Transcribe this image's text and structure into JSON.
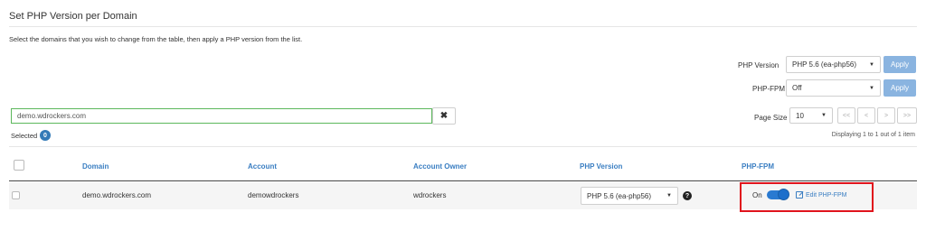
{
  "page": {
    "title": "Set PHP Version per Domain",
    "description": "Select the domains that you wish to change from the table, then apply a PHP version from the list."
  },
  "controls": {
    "php_version_label": "PHP Version",
    "php_version_value": "PHP 5.6 (ea-php56)",
    "php_fpm_label": "PHP-FPM",
    "php_fpm_value": "Off",
    "apply_label": "Apply"
  },
  "search": {
    "value": "demo.wdrockers.com",
    "clear_icon": "✖"
  },
  "selection": {
    "label": "Selected",
    "count": "0"
  },
  "pagination": {
    "page_size_label": "Page Size",
    "page_size_value": "10",
    "first": "<<",
    "prev": "<",
    "next": ">",
    "last": ">>",
    "display_info": "Displaying 1 to 1 out of 1 item"
  },
  "table": {
    "columns": {
      "domain": "Domain",
      "account": "Account",
      "account_owner": "Account Owner",
      "php_version": "PHP Version",
      "php_fpm": "PHP-FPM"
    },
    "rows": [
      {
        "domain": "demo.wdrockers.com",
        "account": "demowdrockers",
        "account_owner": "wdrockers",
        "php_version": "PHP 5.6 (ea-php56)",
        "php_fpm_state": "On",
        "edit_label": "Edit PHP-FPM"
      }
    ]
  },
  "colors": {
    "accent": "#3a7ec2",
    "apply_button": "#8ab4e0",
    "search_border": "#5cb85c",
    "highlight": "#e0141c",
    "toggle_on": "#2a7ad1"
  },
  "icons": {
    "help": "?",
    "caret": "▼"
  }
}
